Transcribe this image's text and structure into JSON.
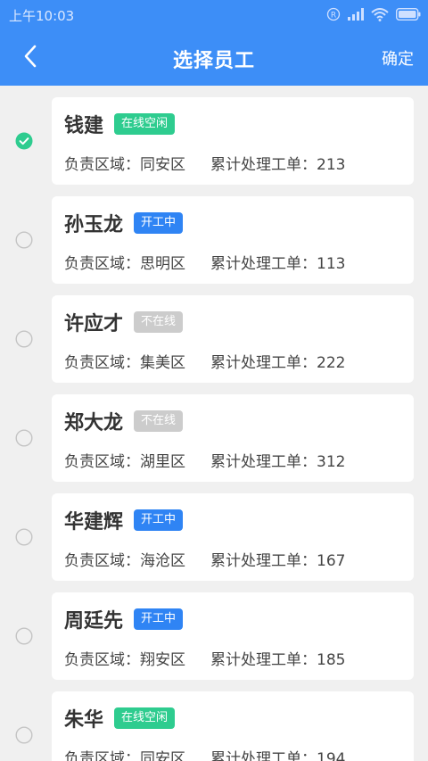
{
  "status_bar": {
    "time": "上午10:03"
  },
  "nav": {
    "title": "选择员工",
    "confirm_label": "确定"
  },
  "colors": {
    "primary": "#3d8ef7",
    "idle": "#2ecc8f",
    "working": "#2f84f4",
    "offline": "#cccccc",
    "check": "#2ecc8f"
  },
  "labels": {
    "area_prefix": "负责区域：",
    "orders_prefix": "累计处理工单："
  },
  "employees": [
    {
      "name": "钱建",
      "status": "在线空闲",
      "status_type": "idle",
      "area": "同安区",
      "orders": "213",
      "selected": true
    },
    {
      "name": "孙玉龙",
      "status": "开工中",
      "status_type": "working",
      "area": "思明区",
      "orders": "113",
      "selected": false
    },
    {
      "name": "许应才",
      "status": "不在线",
      "status_type": "offline",
      "area": "集美区",
      "orders": "222",
      "selected": false
    },
    {
      "name": "郑大龙",
      "status": "不在线",
      "status_type": "offline",
      "area": "湖里区",
      "orders": "312",
      "selected": false
    },
    {
      "name": "华建辉",
      "status": "开工中",
      "status_type": "working",
      "area": "海沧区",
      "orders": "167",
      "selected": false
    },
    {
      "name": "周廷先",
      "status": "开工中",
      "status_type": "working",
      "area": "翔安区",
      "orders": "185",
      "selected": false
    },
    {
      "name": "朱华",
      "status": "在线空闲",
      "status_type": "idle",
      "area": "同安区",
      "orders": "194",
      "selected": false
    }
  ]
}
